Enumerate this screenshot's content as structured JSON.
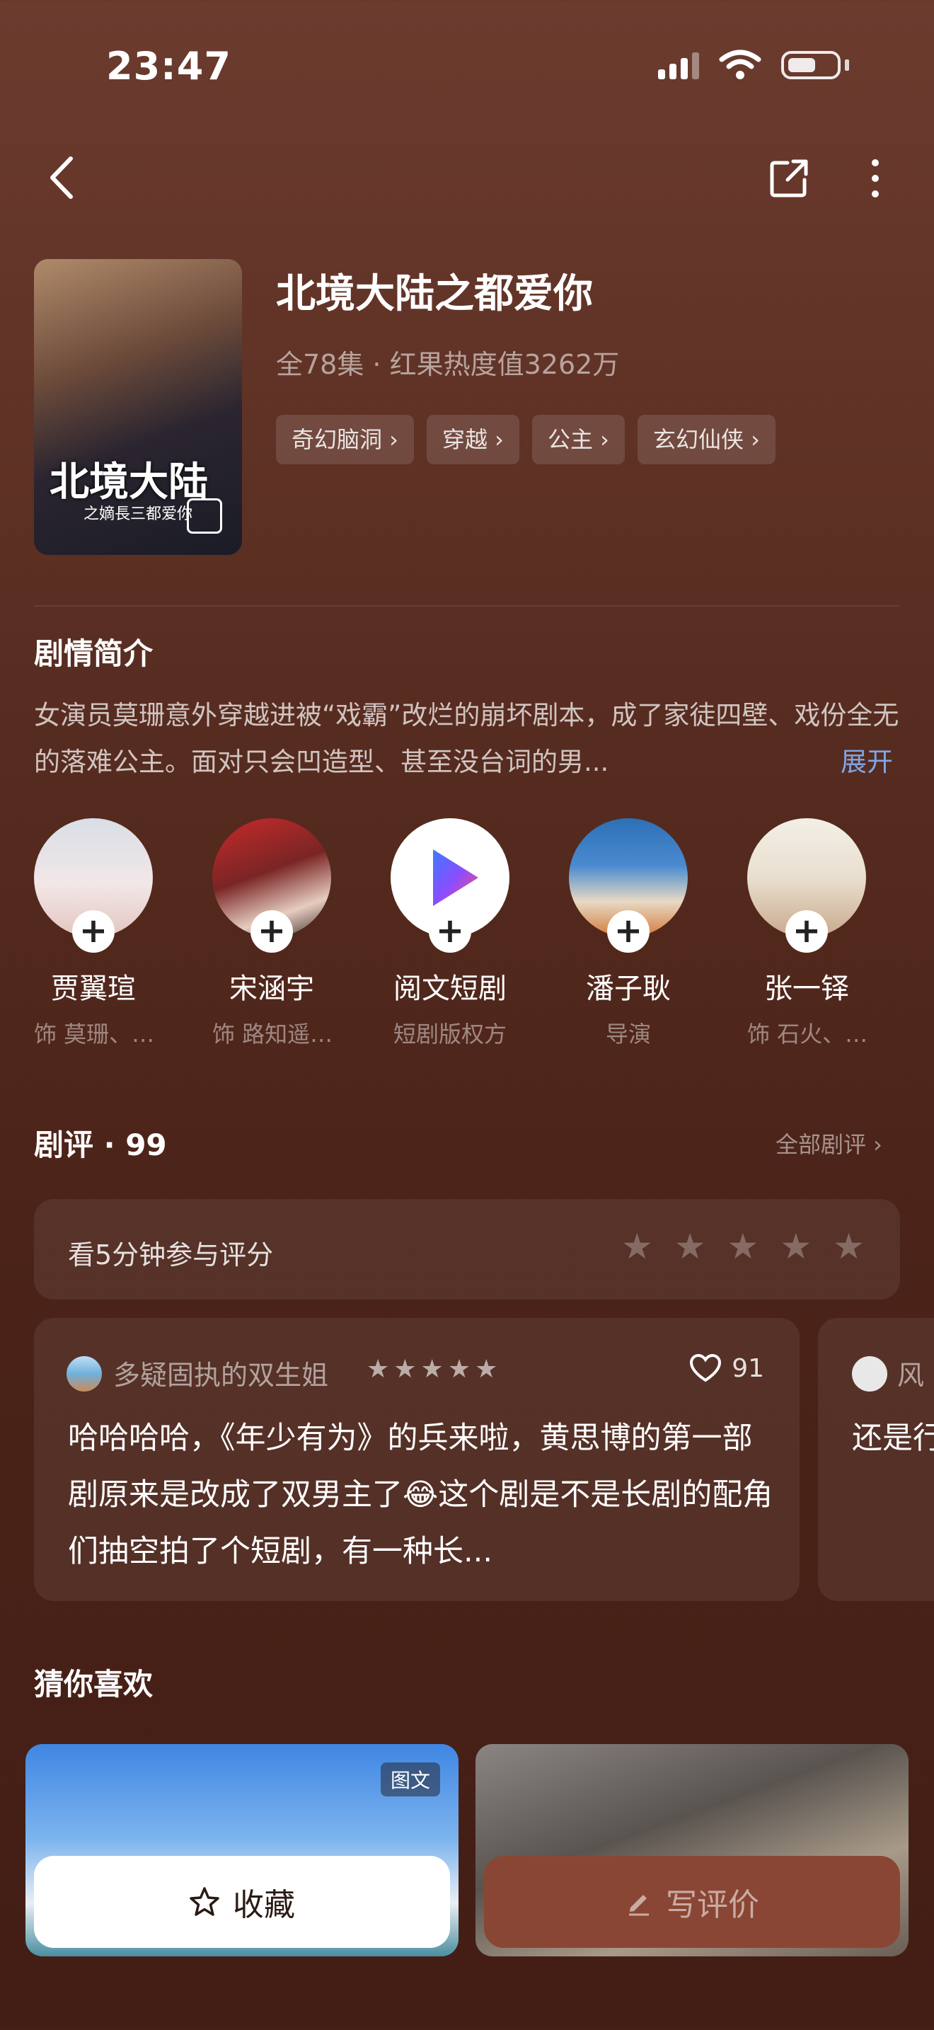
{
  "status_bar": {
    "time": "23:47"
  },
  "nav": {
    "back_icon": "chevron-left-icon",
    "share_icon": "share-icon",
    "more_icon": "more-vertical-icon"
  },
  "drama": {
    "poster_title": "北境大陆",
    "poster_subtitle": "之嫡長三都爱你",
    "title": "北境大陆之都爱你",
    "meta": "全78集 · 红果热度值3262万",
    "tags": [
      "奇幻脑洞 ›",
      "穿越 ›",
      "公主 ›",
      "玄幻仙侠 ›"
    ]
  },
  "synopsis": {
    "heading": "剧情简介",
    "text": "女演员莫珊意外穿越进被“戏霸”改烂的崩坏剧本，成了家徒四壁、戏份全无的落难公主。面对只会凹造型、甚至没台词的男...",
    "expand_label": "展开"
  },
  "cast": [
    {
      "name": "贾翼瑄",
      "role": "饰 莫珊、…"
    },
    {
      "name": "宋涵宇",
      "role": "饰 路知遥…"
    },
    {
      "name": "阅文短剧",
      "role": "短剧版权方"
    },
    {
      "name": "潘子耿",
      "role": "导演"
    },
    {
      "name": "张一铎",
      "role": "饰 石火、…"
    }
  ],
  "reviews": {
    "heading": "剧评 · 99",
    "all_label": "全部剧评 ›",
    "rate_prompt": "看5分钟参与评分",
    "items": [
      {
        "user": "多疑固执的双生姐",
        "stars": "★★★★★",
        "likes": "91",
        "text": "哈哈哈哈，《年少有为》的兵来啦，黄思博的第一部剧原来是改成了双男主了😂这个剧是不是长剧的配角们抽空拍了个短剧，有一种长..."
      },
      {
        "user": "风",
        "text": "还是行也是扌😏"
      }
    ]
  },
  "recommend": {
    "heading": "猜你喜欢",
    "badge": "图文"
  },
  "actions": {
    "favorite_label": "收藏",
    "review_label": "写评价"
  }
}
